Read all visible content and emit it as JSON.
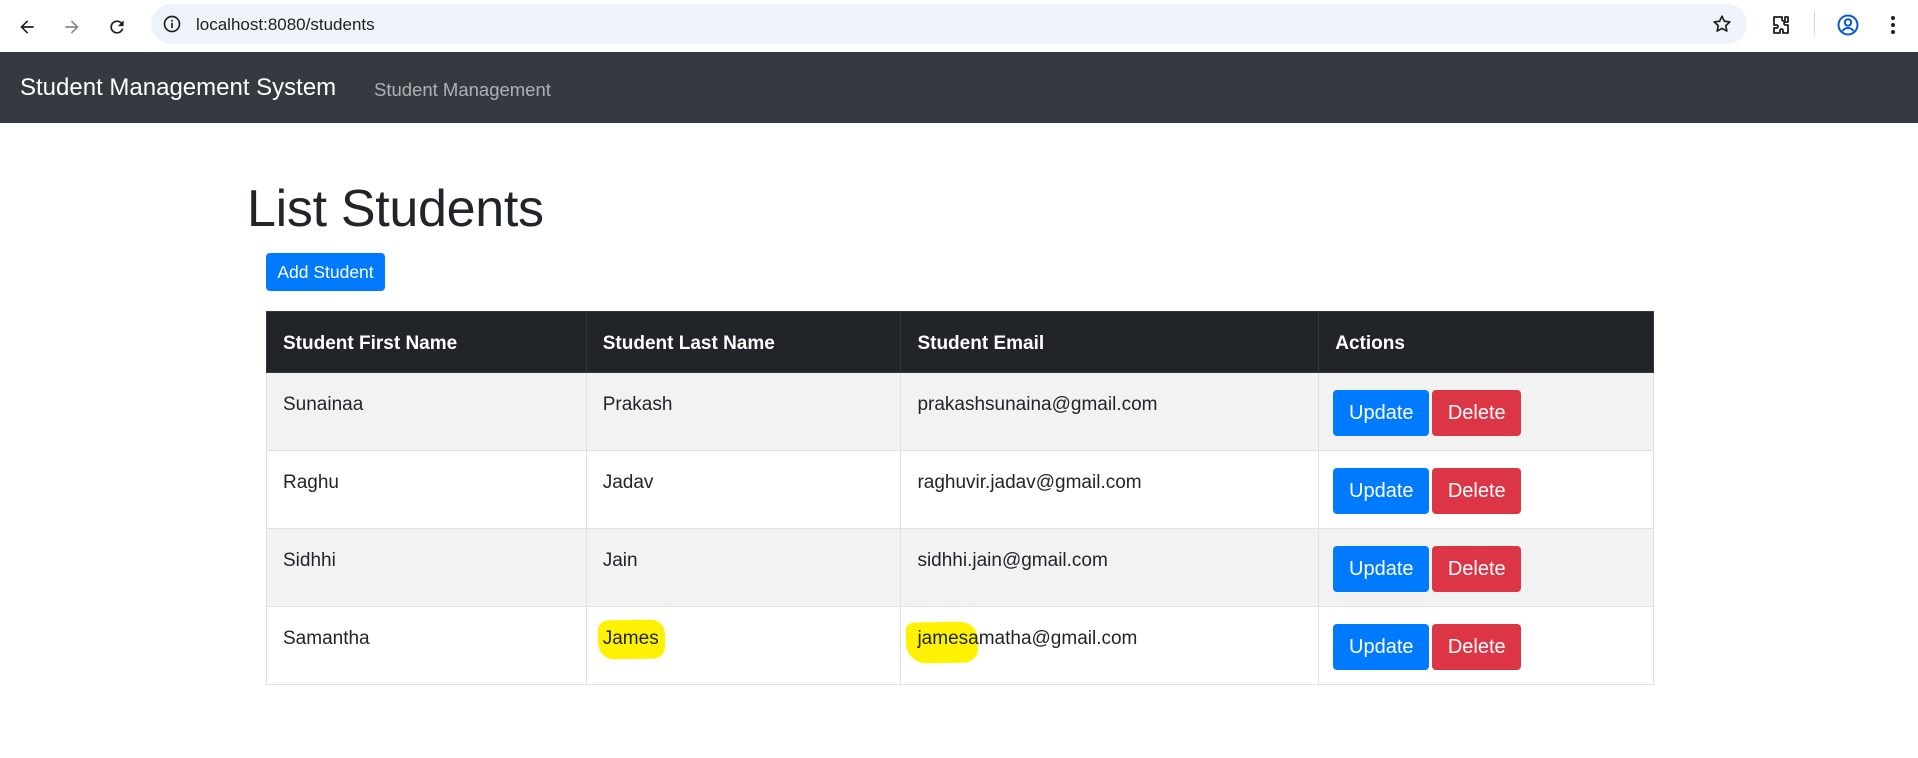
{
  "browser": {
    "url": "localhost:8080/students",
    "icons": [
      "back-arrow-icon",
      "forward-arrow-icon",
      "reload-icon",
      "site-info-icon",
      "bookmark-star-icon",
      "extensions-icon",
      "profile-icon",
      "more-vert-icon"
    ]
  },
  "navbar": {
    "brand": "Student Management System",
    "link": "Student Management"
  },
  "page": {
    "title": "List Students",
    "add_button": "Add Student"
  },
  "table": {
    "headers": [
      "Student First Name",
      "Student Last Name",
      "Student Email",
      "Actions"
    ],
    "rows": [
      {
        "first": "Sunainaa",
        "last": "Prakash",
        "email": "prakashsunaina@gmail.com"
      },
      {
        "first": "Raghu",
        "last": "Jadav",
        "email": "raghuvir.jadav@gmail.com"
      },
      {
        "first": "Sidhhi",
        "last": "Jain",
        "email": "sidhhi.jain@gmail.com"
      },
      {
        "first": "Samantha",
        "last": "James",
        "email_highlight": "jamesa",
        "email_rest": "matha@gmail.com"
      }
    ],
    "update_label": "Update",
    "delete_label": "Delete"
  },
  "colors": {
    "navbar_bg": "#343a40",
    "primary": "#007bff",
    "danger": "#dc3545",
    "table_head_bg": "#212529",
    "highlight": "#fff200"
  }
}
